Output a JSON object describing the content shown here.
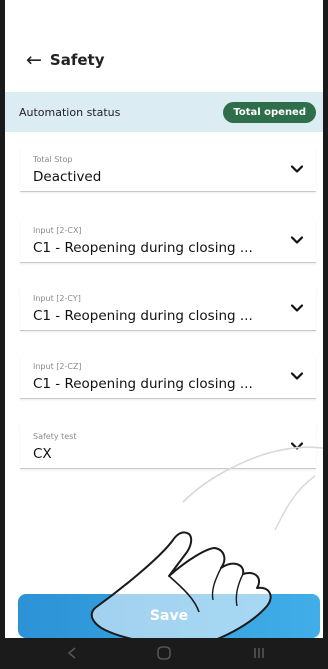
{
  "header": {
    "back_icon": "←",
    "title": "Safety"
  },
  "status": {
    "label": "Automation status",
    "badge": "Total opened",
    "badge_color": "#2f6e4a"
  },
  "fields": [
    {
      "label": "Total Stop",
      "value": "Deactived"
    },
    {
      "label": "Input [2-CX]",
      "value": "C1 - Reopening during closing ..."
    },
    {
      "label": "Input [2-CY]",
      "value": "C1 - Reopening during closing ..."
    },
    {
      "label": "Input [2-CZ]",
      "value": "C1 - Reopening during closing ..."
    },
    {
      "label": "Safety test",
      "value": "CX"
    }
  ],
  "save_button": {
    "label": "Save",
    "color": "#2c93d6"
  },
  "nav_icons": [
    "back-icon",
    "home-icon",
    "recents-icon"
  ]
}
